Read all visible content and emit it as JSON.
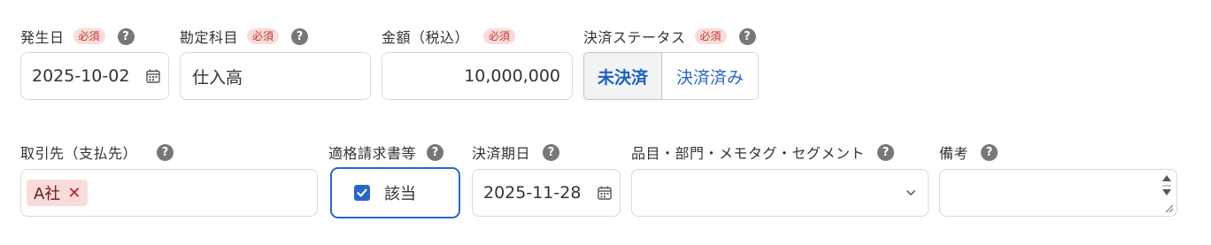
{
  "row1": {
    "occurrence_date": {
      "label": "発生日",
      "required": "必須",
      "help": "?",
      "value": "2025-10-02"
    },
    "account": {
      "label": "勘定科目",
      "required": "必須",
      "help": "?",
      "value": "仕入高"
    },
    "amount": {
      "label": "金額（税込）",
      "required": "必須",
      "value": "10,000,000"
    },
    "settlement_status": {
      "label": "決済ステータス",
      "required": "必須",
      "help": "?",
      "options": [
        "未決済",
        "決済済み"
      ],
      "selected": "未決済"
    }
  },
  "row2": {
    "partner": {
      "label": "取引先（支払先）",
      "help": "?",
      "tag": "A社",
      "tag_remove": "✕"
    },
    "qualified_invoice": {
      "label": "適格請求書等",
      "help": "?",
      "checkbox_label": "該当",
      "checked": true
    },
    "due_date": {
      "label": "決済期日",
      "help": "?",
      "value": "2025-11-28"
    },
    "segments": {
      "label": "品目・部門・メモタグ・セグメント",
      "help": "?",
      "value": ""
    },
    "memo": {
      "label": "備考",
      "help": "?",
      "value": ""
    }
  },
  "colors": {
    "accent": "#2a66c8",
    "required_bg": "#fadbdb",
    "required_text": "#c0392b",
    "border": "#d9d9d9"
  },
  "icons": [
    "calendar-icon",
    "help-icon",
    "chevron-down-icon",
    "check-icon",
    "close-icon",
    "spinner-icon",
    "resize-handle-icon"
  ]
}
